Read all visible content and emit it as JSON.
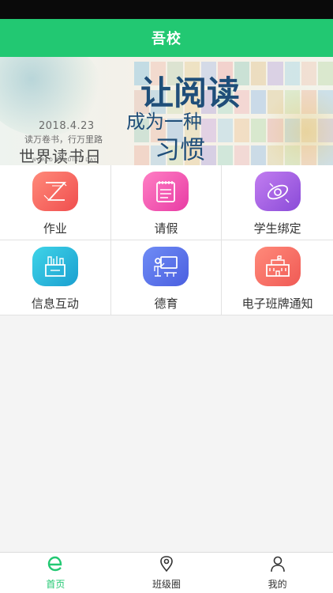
{
  "header": {
    "title": "吾校"
  },
  "banner": {
    "date": "2018.4.23",
    "subtitle": "读万卷书，行万里路",
    "title": "世界读书日",
    "title_en": "WORLD READING DAY",
    "slogan_1": "让阅读",
    "slogan_2": "成为一种",
    "slogan_3": "习惯"
  },
  "menu": [
    {
      "label": "作业",
      "icon": "homework-icon",
      "color_from": "#ff8a7a",
      "color_to": "#f04e4e"
    },
    {
      "label": "请假",
      "icon": "leave-request-icon",
      "color_from": "#ff7fc4",
      "color_to": "#e83ba4"
    },
    {
      "label": "学生绑定",
      "icon": "student-binding-icon",
      "color_from": "#c27df0",
      "color_to": "#8a4bd8"
    },
    {
      "label": "信息互动",
      "icon": "message-interaction-icon",
      "color_from": "#3fd4e8",
      "color_to": "#1a9fd0"
    },
    {
      "label": "德育",
      "icon": "moral-education-icon",
      "color_from": "#6f8cf5",
      "color_to": "#4b5fe0"
    },
    {
      "label": "电子班牌通知",
      "icon": "class-board-notice-icon",
      "color_from": "#ff8a7a",
      "color_to": "#f05a55"
    }
  ],
  "tabs": [
    {
      "label": "首页",
      "icon": "home-e-icon",
      "active": true
    },
    {
      "label": "班级圈",
      "icon": "location-pin-icon",
      "active": false
    },
    {
      "label": "我的",
      "icon": "profile-icon",
      "active": false
    }
  ],
  "colors": {
    "accent": "#22c872",
    "status_bar": "#0a0a0a"
  }
}
